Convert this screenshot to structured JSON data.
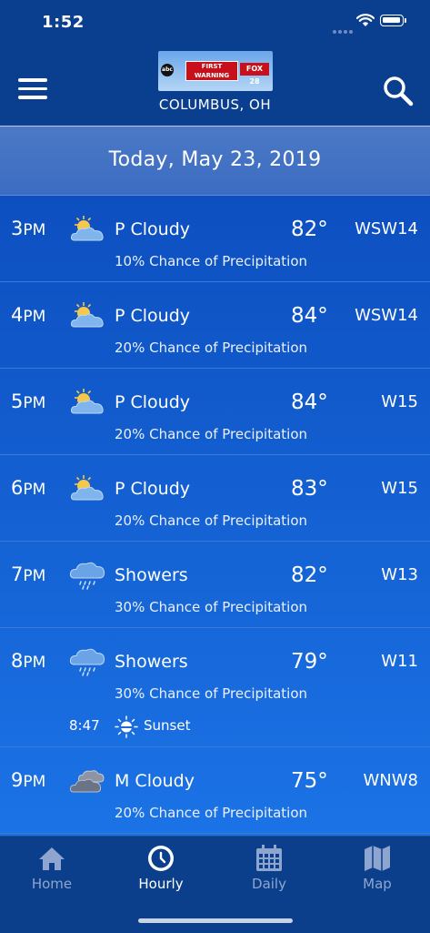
{
  "status_bar": {
    "time": "1:52"
  },
  "header": {
    "logo": {
      "abc": "abc",
      "line1": "FIRST",
      "line2": "WARNING",
      "fox": "FOX 28"
    },
    "location": "COLUMBUS, OH"
  },
  "date_banner": {
    "text": "Today, May 23, 2019"
  },
  "colors": {
    "header_bg": "#0a3e8e",
    "list_top": "#0d4fc0",
    "list_bottom": "#1b73e6",
    "tab_inactive": "#8ea6cf"
  },
  "hours": [
    {
      "hour": "3",
      "ampm": "PM",
      "icon": "partly-cloudy-icon",
      "condition": "P Cloudy",
      "temp": "82°",
      "wind": "WSW14",
      "precip": "10% Chance of Precipitation"
    },
    {
      "hour": "4",
      "ampm": "PM",
      "icon": "partly-cloudy-icon",
      "condition": "P Cloudy",
      "temp": "84°",
      "wind": "WSW14",
      "precip": "20% Chance of Precipitation"
    },
    {
      "hour": "5",
      "ampm": "PM",
      "icon": "partly-cloudy-icon",
      "condition": "P Cloudy",
      "temp": "84°",
      "wind": "W15",
      "precip": "20% Chance of Precipitation"
    },
    {
      "hour": "6",
      "ampm": "PM",
      "icon": "partly-cloudy-icon",
      "condition": "P Cloudy",
      "temp": "83°",
      "wind": "W15",
      "precip": "20% Chance of Precipitation"
    },
    {
      "hour": "7",
      "ampm": "PM",
      "icon": "showers-icon",
      "condition": "Showers",
      "temp": "82°",
      "wind": "W13",
      "precip": "30% Chance of Precipitation"
    },
    {
      "hour": "8",
      "ampm": "PM",
      "icon": "showers-icon",
      "condition": "Showers",
      "temp": "79°",
      "wind": "W11",
      "precip": "30% Chance of Precipitation",
      "sunset": {
        "time": "8:47",
        "label": "Sunset"
      }
    },
    {
      "hour": "9",
      "ampm": "PM",
      "icon": "mostly-cloudy-icon",
      "condition": "M Cloudy",
      "temp": "75°",
      "wind": "WNW8",
      "precip": "20% Chance of Precipitation"
    }
  ],
  "tabs": [
    {
      "label": "Home",
      "icon": "home-icon",
      "active": false
    },
    {
      "label": "Hourly",
      "icon": "clock-icon",
      "active": true
    },
    {
      "label": "Daily",
      "icon": "calendar-icon",
      "active": false
    },
    {
      "label": "Map",
      "icon": "map-icon",
      "active": false
    }
  ]
}
